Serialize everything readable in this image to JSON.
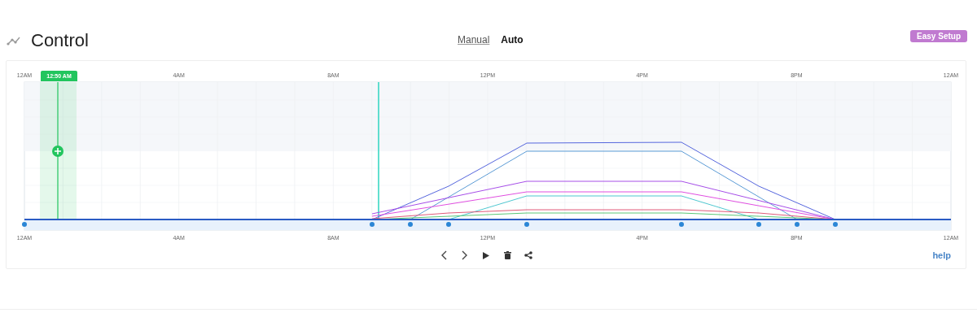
{
  "header": {
    "title": "Control",
    "mode_tabs": [
      {
        "label": "Manual",
        "selected": false
      },
      {
        "label": "Auto",
        "selected": true
      }
    ],
    "easy_setup_button": "Easy Setup"
  },
  "schedule": {
    "time_marker": "12:50 AM",
    "top_axis_labels": [
      "12AM",
      "4AM",
      "8AM",
      "12PM",
      "4PM",
      "8PM",
      "12AM"
    ],
    "bottom_axis_labels": [
      "12AM",
      "4AM",
      "8AM",
      "12PM",
      "4PM",
      "8PM",
      "12AM"
    ]
  },
  "controls": {
    "help_link": "help"
  }
}
